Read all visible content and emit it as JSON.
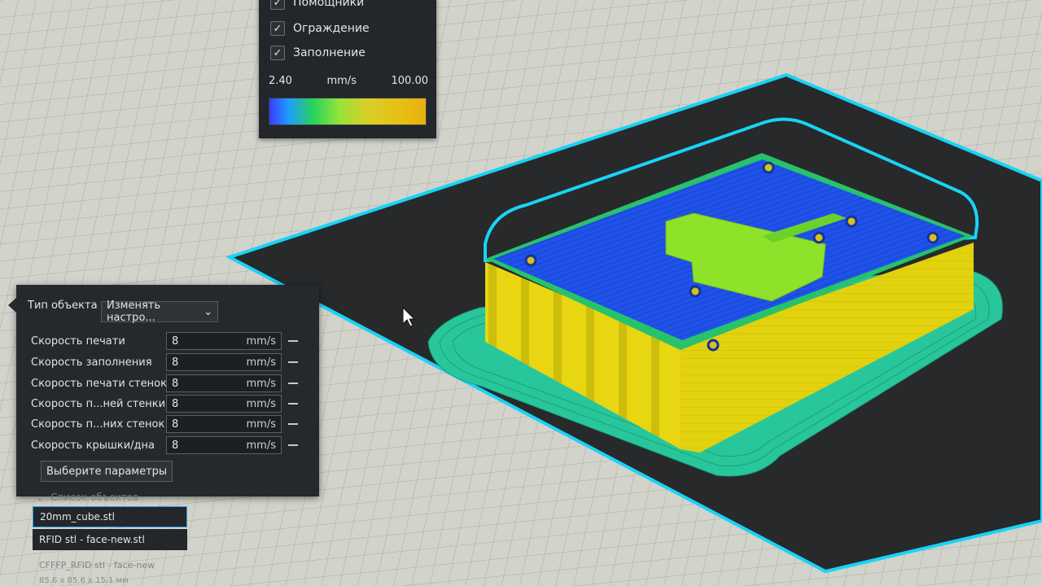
{
  "legend": {
    "items": [
      {
        "label": "Помощники",
        "checked": true
      },
      {
        "label": "Ограждение",
        "checked": true
      },
      {
        "label": "Заполнение",
        "checked": true
      }
    ],
    "min_value": "2.40",
    "unit": "mm/s",
    "max_value": "100.00",
    "check_glyph": "✓"
  },
  "settings": {
    "object_type_label": "Тип объекта",
    "object_type_value": "Изменять настро...",
    "chevron": "⌄",
    "params": [
      {
        "label": "Скорость печати",
        "value": "8",
        "unit": "mm/s"
      },
      {
        "label": "Скорость заполнения",
        "value": "8",
        "unit": "mm/s"
      },
      {
        "label": "Скорость печати стенок",
        "value": "8",
        "unit": "mm/s"
      },
      {
        "label": "Скорость п...ней стенки",
        "value": "8",
        "unit": "mm/s"
      },
      {
        "label": "Скорость п...них стенок",
        "value": "8",
        "unit": "mm/s"
      },
      {
        "label": "Скорость крышки/дна",
        "value": "8",
        "unit": "mm/s"
      }
    ],
    "choose_button": "Выберите параметры"
  },
  "object_list": {
    "header": "Список объектов",
    "items": [
      {
        "name": "20mm_cube.stl",
        "selected": true
      },
      {
        "name": "RFID stl - face-new.stl",
        "selected": false
      }
    ],
    "footer": "CFFFP_RFID stl - face-new",
    "dimensions": "85.6 x 85.6 x 15.1 мм"
  },
  "colors": {
    "accent_border": "#19d3f5",
    "bed": "#27292b",
    "brim": "#27c79b",
    "walls": "#e2d20e",
    "top": "#1f4fe8",
    "infill": "#8fe22a"
  }
}
